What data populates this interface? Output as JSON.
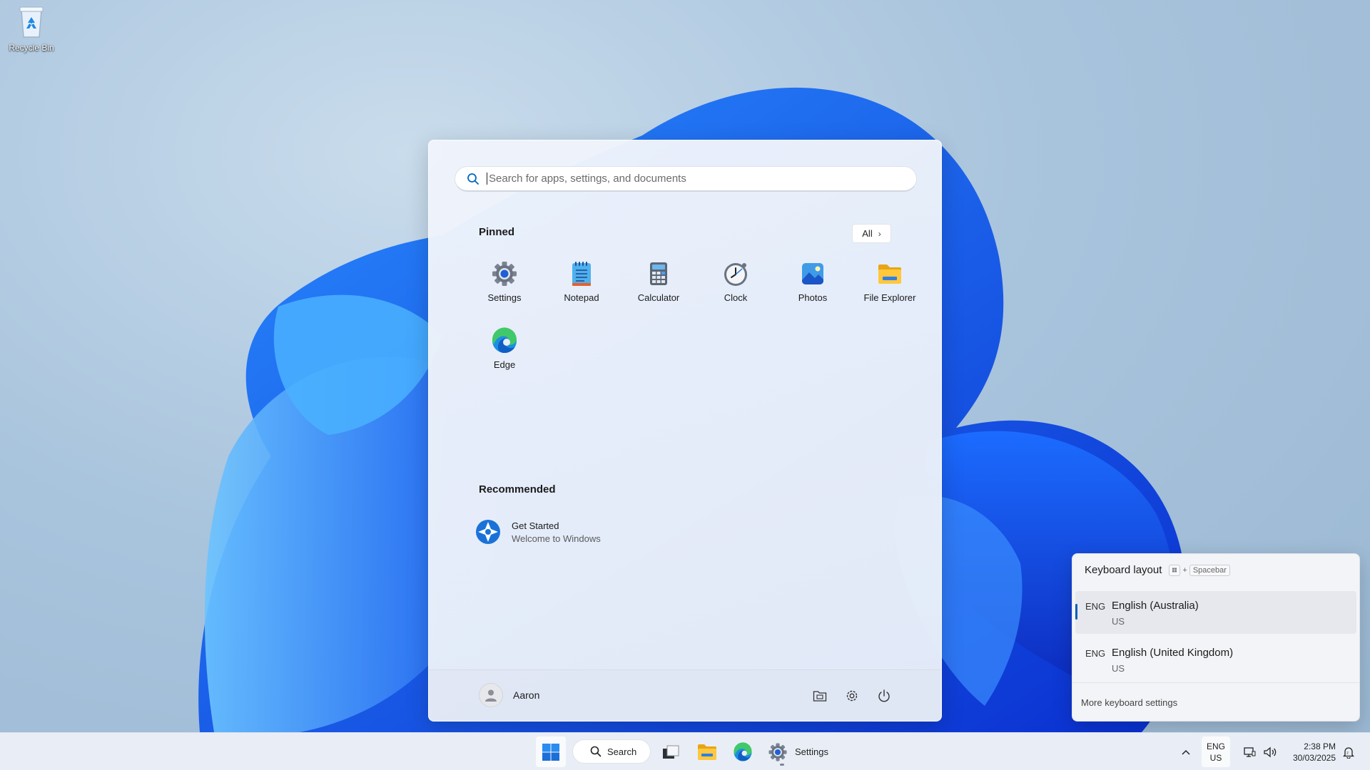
{
  "desktop": {
    "icons": [
      {
        "label": "Recycle Bin",
        "icon": "recycle-bin-icon"
      }
    ]
  },
  "start_menu": {
    "search_placeholder": "Search for apps, settings, and documents",
    "pinned_title": "Pinned",
    "all_button": "All",
    "pinned": [
      {
        "label": "Settings",
        "icon": "settings-gear-icon"
      },
      {
        "label": "Notepad",
        "icon": "notepad-icon"
      },
      {
        "label": "Calculator",
        "icon": "calculator-icon"
      },
      {
        "label": "Clock",
        "icon": "clock-icon"
      },
      {
        "label": "Photos",
        "icon": "photos-icon"
      },
      {
        "label": "File Explorer",
        "icon": "folder-icon"
      },
      {
        "label": "Edge",
        "icon": "edge-icon"
      }
    ],
    "recommended_title": "Recommended",
    "recommended": [
      {
        "title": "Get Started",
        "subtitle": "Welcome to Windows",
        "icon": "get-started-icon"
      }
    ],
    "user_name": "Aaron",
    "footer_buttons": [
      "documents-folder-icon",
      "settings-gear-icon",
      "power-icon"
    ]
  },
  "keyboard_layout": {
    "title": "Keyboard layout",
    "shortcut_plus": "+",
    "shortcut_key": "Spacebar",
    "layouts": [
      {
        "abbr": "ENG",
        "name": "English (Australia)",
        "sub": "US",
        "selected": true
      },
      {
        "abbr": "ENG",
        "name": "English (United Kingdom)",
        "sub": "US",
        "selected": false
      }
    ],
    "more_link": "More keyboard settings"
  },
  "taskbar": {
    "search_label": "Search",
    "settings_label": "Settings",
    "lang_top": "ENG",
    "lang_bottom": "US",
    "time": "2:38 PM",
    "date": "30/03/2025",
    "accent": "#0067c0"
  }
}
